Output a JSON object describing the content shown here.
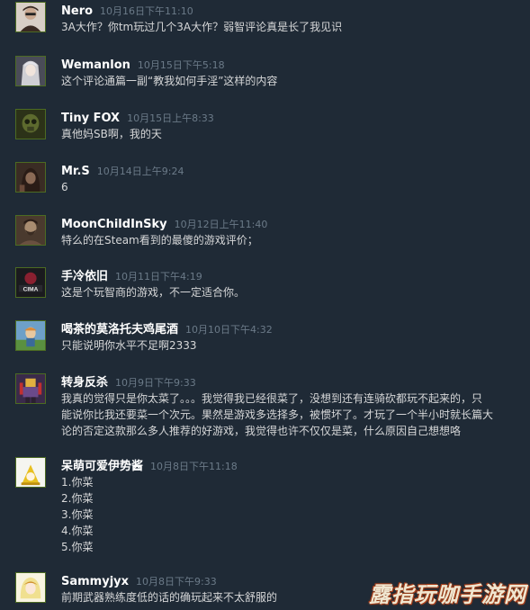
{
  "comments": [
    {
      "author": "Nero",
      "time": "10月16日下午11:10",
      "lines": [
        "3A大作？你tm玩过几个3A大作？弱智评论真是长了我见识"
      ],
      "avatar_icon": "man-portrait-avatar-icon",
      "avatar_colors": [
        "#c9b7a8",
        "#3a2a22"
      ]
    },
    {
      "author": "Wemanlon",
      "time": "10月15日下午5:18",
      "lines": [
        "这个评论通篇一副“教我如何手淫”这样的内容"
      ],
      "avatar_icon": "silver-hair-anime-avatar-icon",
      "avatar_colors": [
        "#cfcfd4",
        "#3a3b44"
      ]
    },
    {
      "author": "Tiny FOX",
      "time": "10月15日上午8:33",
      "lines": [
        "真他妈SB啊，我的天"
      ],
      "avatar_icon": "soldier-mask-avatar-icon",
      "avatar_colors": [
        "#5d6a2e",
        "#1c2010"
      ]
    },
    {
      "author": "Mr.S",
      "time": "10月14日上午9:24",
      "lines": [
        "6"
      ],
      "avatar_icon": "hooded-figure-avatar-icon",
      "avatar_colors": [
        "#8a6a55",
        "#2a1c16"
      ]
    },
    {
      "author": "MoonChildInSky",
      "time": "10月12日上午11:40",
      "lines": [
        "特么的在Steam看到的最傻的游戏评价；"
      ],
      "avatar_icon": "bearded-man-avatar-icon",
      "avatar_colors": [
        "#a88c70",
        "#3a2c22"
      ]
    },
    {
      "author": "手冷依旧",
      "time": "10月11日下午4:19",
      "lines": [
        "这是个玩智商的游戏，不一定适合你。"
      ],
      "avatar_icon": "cinema-logo-avatar-icon",
      "avatar_colors": [
        "#8a2030",
        "#e8e8e8"
      ]
    },
    {
      "author": "喝茶的莫洛托夫鸡尾酒",
      "time": "10月10日下午4:32",
      "lines": [
        "只能说明你水平不足啊2333"
      ],
      "avatar_icon": "cartoon-character-avatar-icon",
      "avatar_colors": [
        "#6ea0c8",
        "#d88a3a"
      ]
    },
    {
      "author": "转身反杀",
      "time": "10月9日下午9:33",
      "lines": [
        "我真的觉得只是你太菜了。。。我觉得我已经很菜了，没想到还有连骑砍都玩不起来的，只",
        "能说你比我还要菜一个次元。果然是游戏多选择多，被惯坏了。才玩了一个半小时就长篇大",
        "论的否定这款那么多人推荐的好游戏，我觉得也许不仅仅是菜，什么原因自己想想咯"
      ],
      "avatar_icon": "pixel-warrior-avatar-icon",
      "avatar_colors": [
        "#6a4a8a",
        "#e0b040"
      ]
    },
    {
      "author": "呆萌可爱伊势酱",
      "time": "10月8日下午11:18",
      "lines": [
        "1.你菜",
        "2.你菜",
        "3.你菜",
        "4.你菜",
        "5.你菜"
      ],
      "avatar_icon": "anime-girl-yellow-avatar-icon",
      "avatar_colors": [
        "#f5f5f0",
        "#e8c020"
      ]
    },
    {
      "author": "Sammyjyx",
      "time": "10月8日下午9:33",
      "lines": [
        "前期武器熟练度低的话的确玩起来不太舒服的"
      ],
      "avatar_icon": "blonde-anime-avatar-icon",
      "avatar_colors": [
        "#f0e090",
        "#d09030"
      ]
    }
  ],
  "watermark": "露指玩咖手游网"
}
